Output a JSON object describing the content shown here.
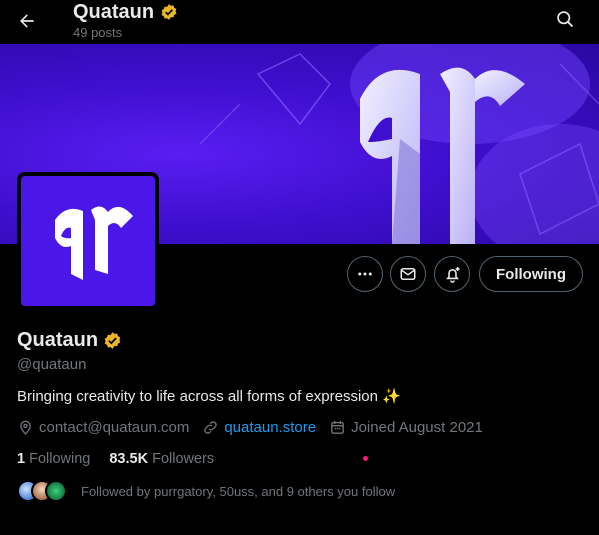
{
  "header": {
    "title": "Quataun",
    "posts": "49 posts",
    "back_icon": "arrow-left-icon",
    "search_icon": "search-icon"
  },
  "banner": {
    "logo_text": "qr"
  },
  "avatar": {
    "logo_text": "qr"
  },
  "actions": {
    "more_icon": "ellipsis-icon",
    "message_icon": "envelope-icon",
    "notify_icon": "bell-plus-icon",
    "following_label": "Following"
  },
  "profile": {
    "name": "Quataun",
    "handle": "@quataun",
    "bio": "Bringing creativity to life across all forms of expression",
    "bio_emoji": "✨",
    "email": "contact@quataun.com",
    "website": "quataun.store",
    "joined": "Joined August 2021",
    "following_count": "1",
    "following_label": "Following",
    "followers_count": "83.5K",
    "followers_label": "Followers",
    "followed_by": "Followed by purrgatory, 50uss, and 9 others you follow"
  },
  "colors": {
    "accent": "#1d9bf0",
    "brand": "#4b17e8",
    "verified": "#e8b62c"
  }
}
